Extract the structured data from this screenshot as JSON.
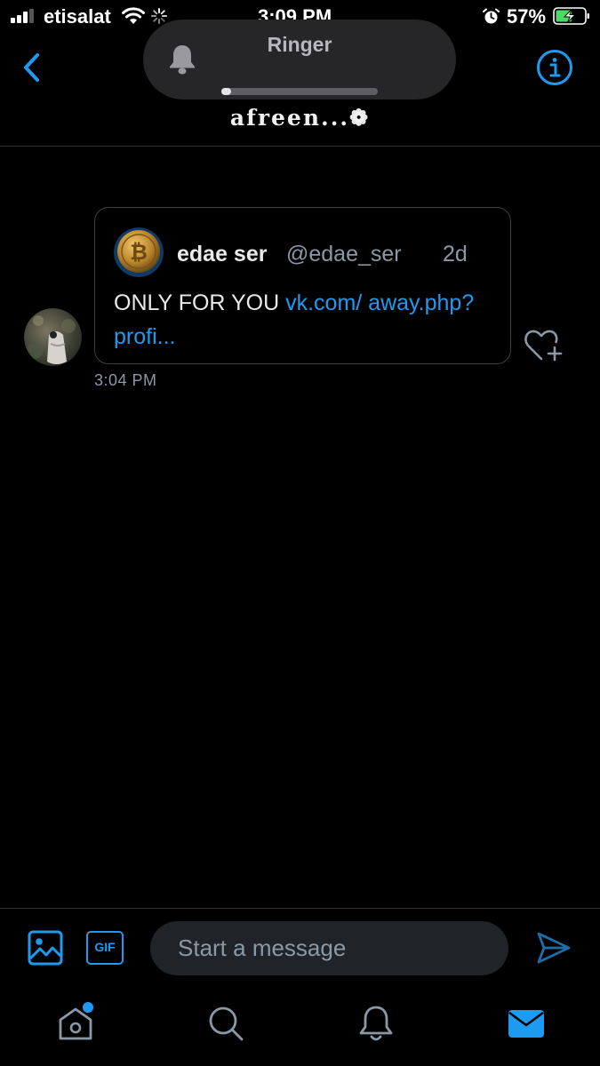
{
  "status_bar": {
    "carrier": "etisalat",
    "time": "3:09 PM",
    "battery_percent": "57%",
    "battery_level": 0.57,
    "charging": true,
    "alarm_icon": "alarm-clock-icon",
    "wifi_icon": "wifi-icon",
    "activity_icon": "loading-spinner-icon"
  },
  "ringer_hud": {
    "title": "Ringer",
    "icon": "bell-icon",
    "volume_level": 0.06
  },
  "header": {
    "title": "afreen...❁",
    "back_icon": "chevron-left-icon",
    "info_icon": "info-icon"
  },
  "message": {
    "sender_avatar": "avatar-image",
    "time": "3:04 PM",
    "quoted_tweet": {
      "author_name": "edae ser",
      "author_handle": "@edae_ser",
      "age": "2d",
      "text": "ONLY FOR YOU ",
      "link_text": "vk.com/ away.php?profi...",
      "avatar": "bitcoin-coin-avatar"
    },
    "like_icon": "heart-plus-icon"
  },
  "composer": {
    "placeholder": "Start a message",
    "gif_label": "GIF",
    "image_icon": "image-icon",
    "send_icon": "send-icon"
  },
  "tab_bar": {
    "items": [
      {
        "name": "home",
        "icon": "home-icon",
        "has_badge": true
      },
      {
        "name": "search",
        "icon": "search-icon"
      },
      {
        "name": "notifications",
        "icon": "bell-icon"
      },
      {
        "name": "messages",
        "icon": "mail-icon",
        "active": true
      }
    ]
  },
  "colors": {
    "accent": "#1d9bf0",
    "background": "#000000",
    "secondary_text": "#8b98a5",
    "input_background": "#202327"
  }
}
